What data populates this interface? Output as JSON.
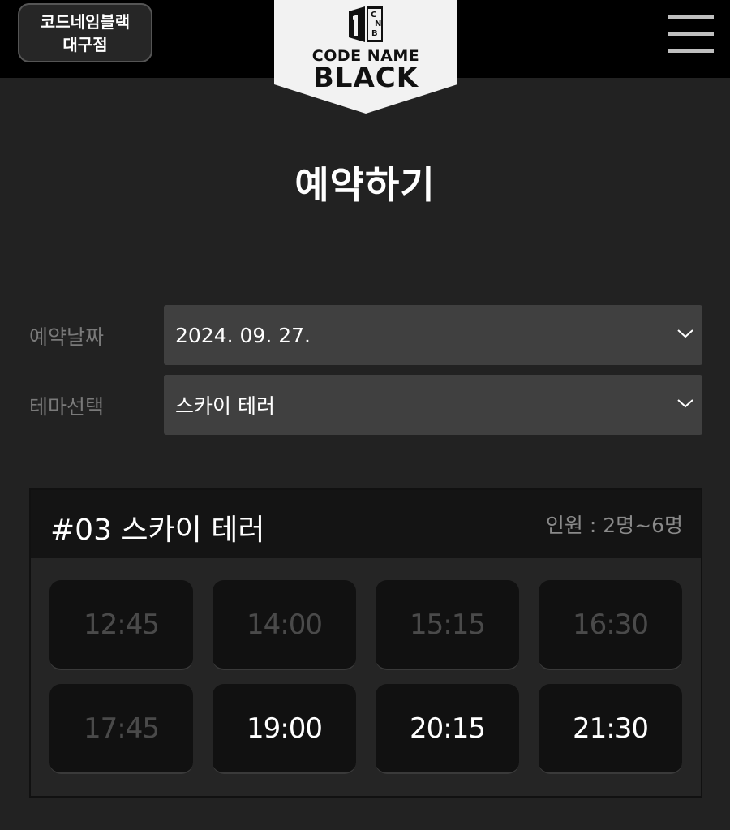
{
  "header": {
    "branch_line1": "코드네임블랙",
    "branch_line2": "대구점",
    "logo_text_top": "CODE NAME",
    "logo_text_bottom": "BLACK",
    "logo_mark_letters": [
      "C",
      "N",
      "B"
    ]
  },
  "page": {
    "title": "예약하기"
  },
  "form": {
    "date_label": "예약날짜",
    "date_value": "2024. 09. 27.",
    "theme_label": "테마선택",
    "theme_value": "스카이 테러"
  },
  "theme": {
    "title": "#03  스카이 테러",
    "capacity": "인원 : 2명~6명",
    "slots": [
      {
        "time": "12:45",
        "available": false
      },
      {
        "time": "14:00",
        "available": false
      },
      {
        "time": "15:15",
        "available": false
      },
      {
        "time": "16:30",
        "available": false
      },
      {
        "time": "17:45",
        "available": false
      },
      {
        "time": "19:00",
        "available": true
      },
      {
        "time": "20:15",
        "available": true
      },
      {
        "time": "21:30",
        "available": true
      }
    ]
  },
  "colors": {
    "background": "#222222",
    "topbar": "#000000",
    "select_bg": "#404040",
    "slot_bg": "#111111",
    "slot_available_text": "#ffffff",
    "slot_unavailable_text": "#4a4a4a"
  },
  "icons": {
    "menu": "hamburger-menu-icon",
    "dropdown": "chevron-down-icon",
    "logo": "code-name-black-logo"
  }
}
